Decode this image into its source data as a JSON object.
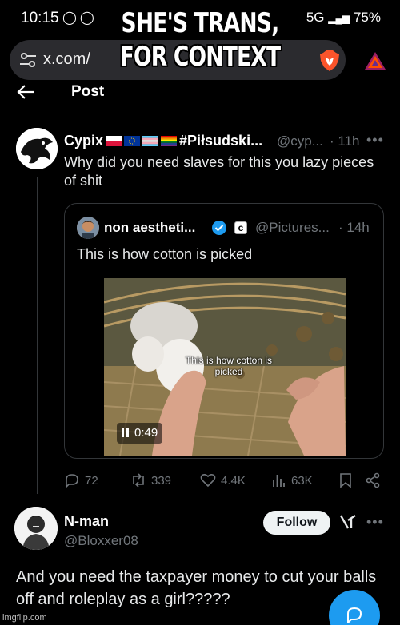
{
  "caption": {
    "line1": "SHE'S TRANS,",
    "line2": "FOR CONTEXT"
  },
  "status_bar": {
    "time": "10:15",
    "network": "5G",
    "battery": "75%"
  },
  "url_bar": {
    "url": "x.com/",
    "icons": [
      "tune-icon",
      "brave-lion-icon",
      "brave-rewards-triangle-icon"
    ]
  },
  "header": {
    "title": "Post"
  },
  "main_post": {
    "author_name": "Cypix",
    "author_suffix": "#Piłsudski...",
    "handle": "@cyp...",
    "time": "· 11h",
    "text": "Why did you need slaves for this you lazy pieces of shit"
  },
  "quoted_post": {
    "author_name": "non aestheti...",
    "handle": "@Pictures...",
    "time": "· 14h",
    "text": "This is how cotton is picked",
    "video_overlay": "This is how cotton is picked",
    "video_time": "0:49"
  },
  "actions": {
    "replies": "72",
    "reposts": "339",
    "likes": "4.4K",
    "views": "63K"
  },
  "reply": {
    "author_name": "N-man",
    "handle": "@Bloxxer08",
    "follow_label": "Follow",
    "text": "And you need the taxpayer money to cut your balls off and roleplay as a girl?????"
  },
  "watermark": "imgflip.com",
  "colors": {
    "background": "#000000",
    "text": "#e7e9ea",
    "muted": "#71767b",
    "accent": "#1d9bf0"
  }
}
